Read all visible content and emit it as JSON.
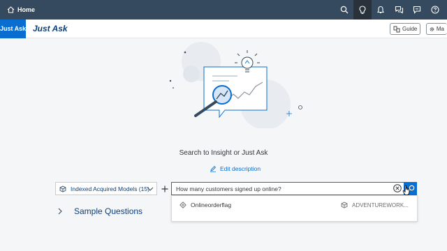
{
  "shell": {
    "home_label": "Home",
    "icons": [
      "search-icon",
      "lightbulb-icon",
      "bell-icon",
      "chat-icon",
      "feedback-icon",
      "help-icon"
    ]
  },
  "app": {
    "tab_label": "Just Ask",
    "title": "Just Ask",
    "guide_label": "Guide",
    "manage_label": "Ma"
  },
  "main": {
    "subtitle": "Search to Insight or Just Ask",
    "edit_description": "Edit description",
    "model_selector": "Indexed Acquired Models (15)",
    "search_value": "How many customers signed up online?",
    "suggestion": {
      "name": "Onlineorderflag",
      "model": "ADVENTUREWORK..."
    },
    "sample_questions": "Sample Questions"
  },
  "colors": {
    "shell_bg": "#354a5f",
    "accent": "#0a6ed1",
    "title": "#0a3f7a"
  }
}
